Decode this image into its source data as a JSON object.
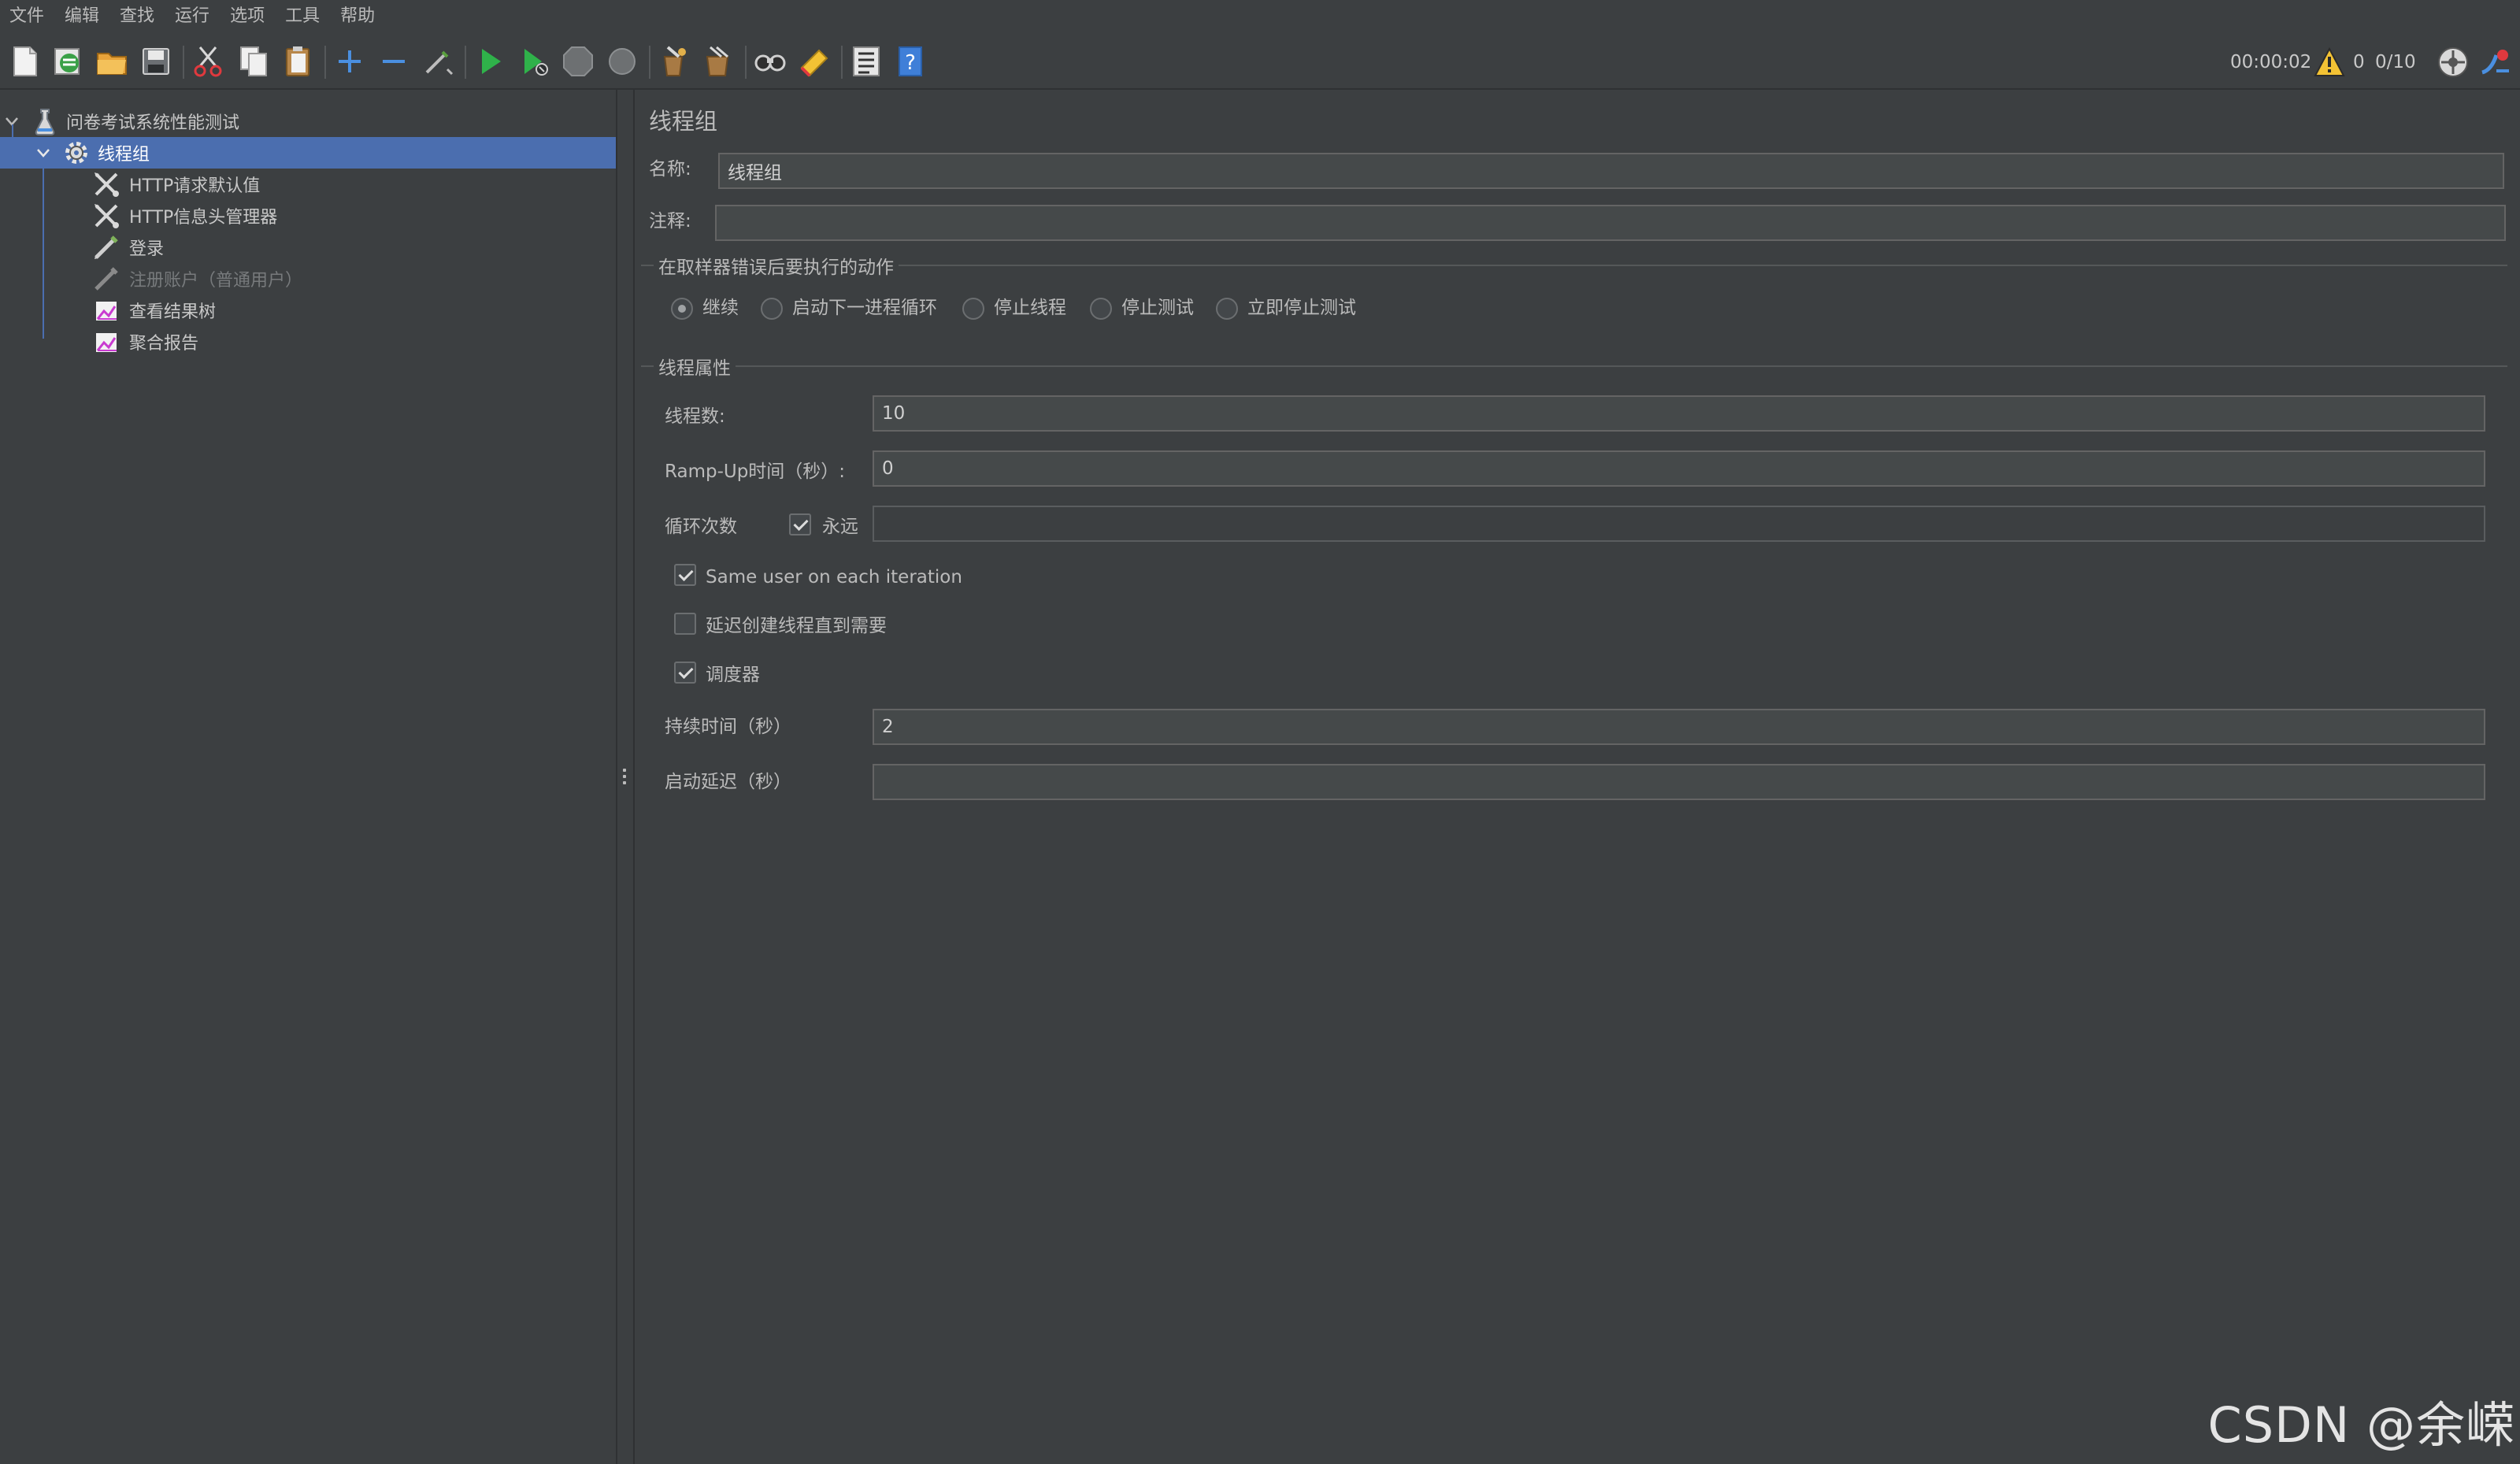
{
  "menu": [
    "文件",
    "编辑",
    "查找",
    "运行",
    "选项",
    "工具",
    "帮助"
  ],
  "toolbar": {
    "buttons": [
      "new-icon",
      "templates-icon",
      "open-icon",
      "save-icon",
      "cut-icon",
      "copy-icon",
      "paste-icon",
      "expand-icon",
      "collapse-icon",
      "toggle-icon",
      "start-icon",
      "start-no-pause-icon",
      "stop-icon",
      "shutdown-icon",
      "clear-icon",
      "clear-all-icon",
      "search-icon",
      "reset-search-icon",
      "function-helper-icon",
      "help-icon"
    ],
    "status": {
      "elapsed": "00:00:02",
      "warnings": "0",
      "threads": "0/10"
    }
  },
  "tree": {
    "root": "问卷考试系统性能测试",
    "group": "线程组",
    "children": [
      {
        "label": "HTTP请求默认值",
        "icon": "config-element-icon",
        "disabled": false
      },
      {
        "label": "HTTP信息头管理器",
        "icon": "config-element-icon",
        "disabled": false
      },
      {
        "label": "登录",
        "icon": "http-sampler-icon",
        "disabled": false
      },
      {
        "label": "注册账户（普通用户）",
        "icon": "http-sampler-icon",
        "disabled": true
      },
      {
        "label": "查看结果树",
        "icon": "listener-icon",
        "disabled": false
      },
      {
        "label": "聚合报告",
        "icon": "listener-icon",
        "disabled": false
      }
    ]
  },
  "form": {
    "title": "线程组",
    "name_label": "名称:",
    "name_value": "线程组",
    "comment_label": "注释:",
    "comment_value": "",
    "on_error": {
      "title": "在取样器错误后要执行的动作",
      "options": [
        "继续",
        "启动下一进程循环",
        "停止线程",
        "停止测试",
        "立即停止测试"
      ],
      "selected": "继续"
    },
    "thread_props": {
      "title": "线程属性",
      "threads_label": "线程数:",
      "threads_value": "10",
      "rampup_label": "Ramp-Up时间（秒）:",
      "rampup_value": "0",
      "loop_label": "循环次数",
      "forever_label": "永远",
      "forever_checked": true,
      "loop_value": "",
      "same_user_label": "Same user on each iteration",
      "same_user_checked": true,
      "delay_create_label": "延迟创建线程直到需要",
      "delay_create_checked": false,
      "scheduler_label": "调度器",
      "scheduler_checked": true,
      "duration_label": "持续时间（秒）",
      "duration_value": "2",
      "startup_delay_label": "启动延迟（秒）",
      "startup_delay_value": ""
    }
  },
  "watermark": "CSDN @余嵘"
}
